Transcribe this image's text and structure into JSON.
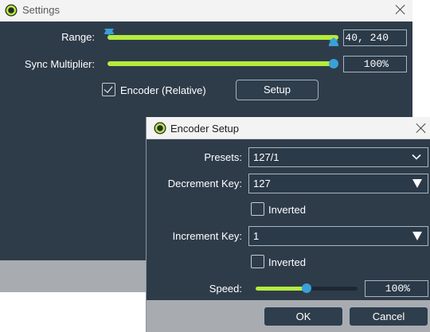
{
  "settings": {
    "title": "Settings",
    "range": {
      "label": "Range:",
      "value": "40, 240",
      "low": 0.0,
      "high": 1.0
    },
    "sync": {
      "label": "Sync Multiplier:",
      "value": "100%",
      "level": 1.0
    },
    "encoder_relative": {
      "label": "Encoder (Relative)",
      "checked": true
    },
    "setup_button": "Setup"
  },
  "encoder_setup": {
    "title": "Encoder Setup",
    "presets": {
      "label": "Presets:",
      "value": "127/1"
    },
    "decrement": {
      "label": "Decrement Key:",
      "value": "127"
    },
    "decrement_inverted": {
      "label": "Inverted",
      "checked": false
    },
    "increment": {
      "label": "Increment Key:",
      "value": "1"
    },
    "increment_inverted": {
      "label": "Inverted",
      "checked": false
    },
    "speed": {
      "label": "Speed:",
      "value": "100%",
      "level": 0.5
    },
    "ok_button": "OK",
    "cancel_button": "Cancel"
  },
  "colors": {
    "panel": "#2e3c4a",
    "track": "#b5ec3c",
    "thumb": "#3aa0d8",
    "titlebar": "#f3f3f3",
    "footer": "#a8acb0"
  },
  "icons": [
    "app-icon",
    "close-icon",
    "checkmark-icon",
    "chevron-down-icon",
    "dropdown-arrow-icon"
  ]
}
